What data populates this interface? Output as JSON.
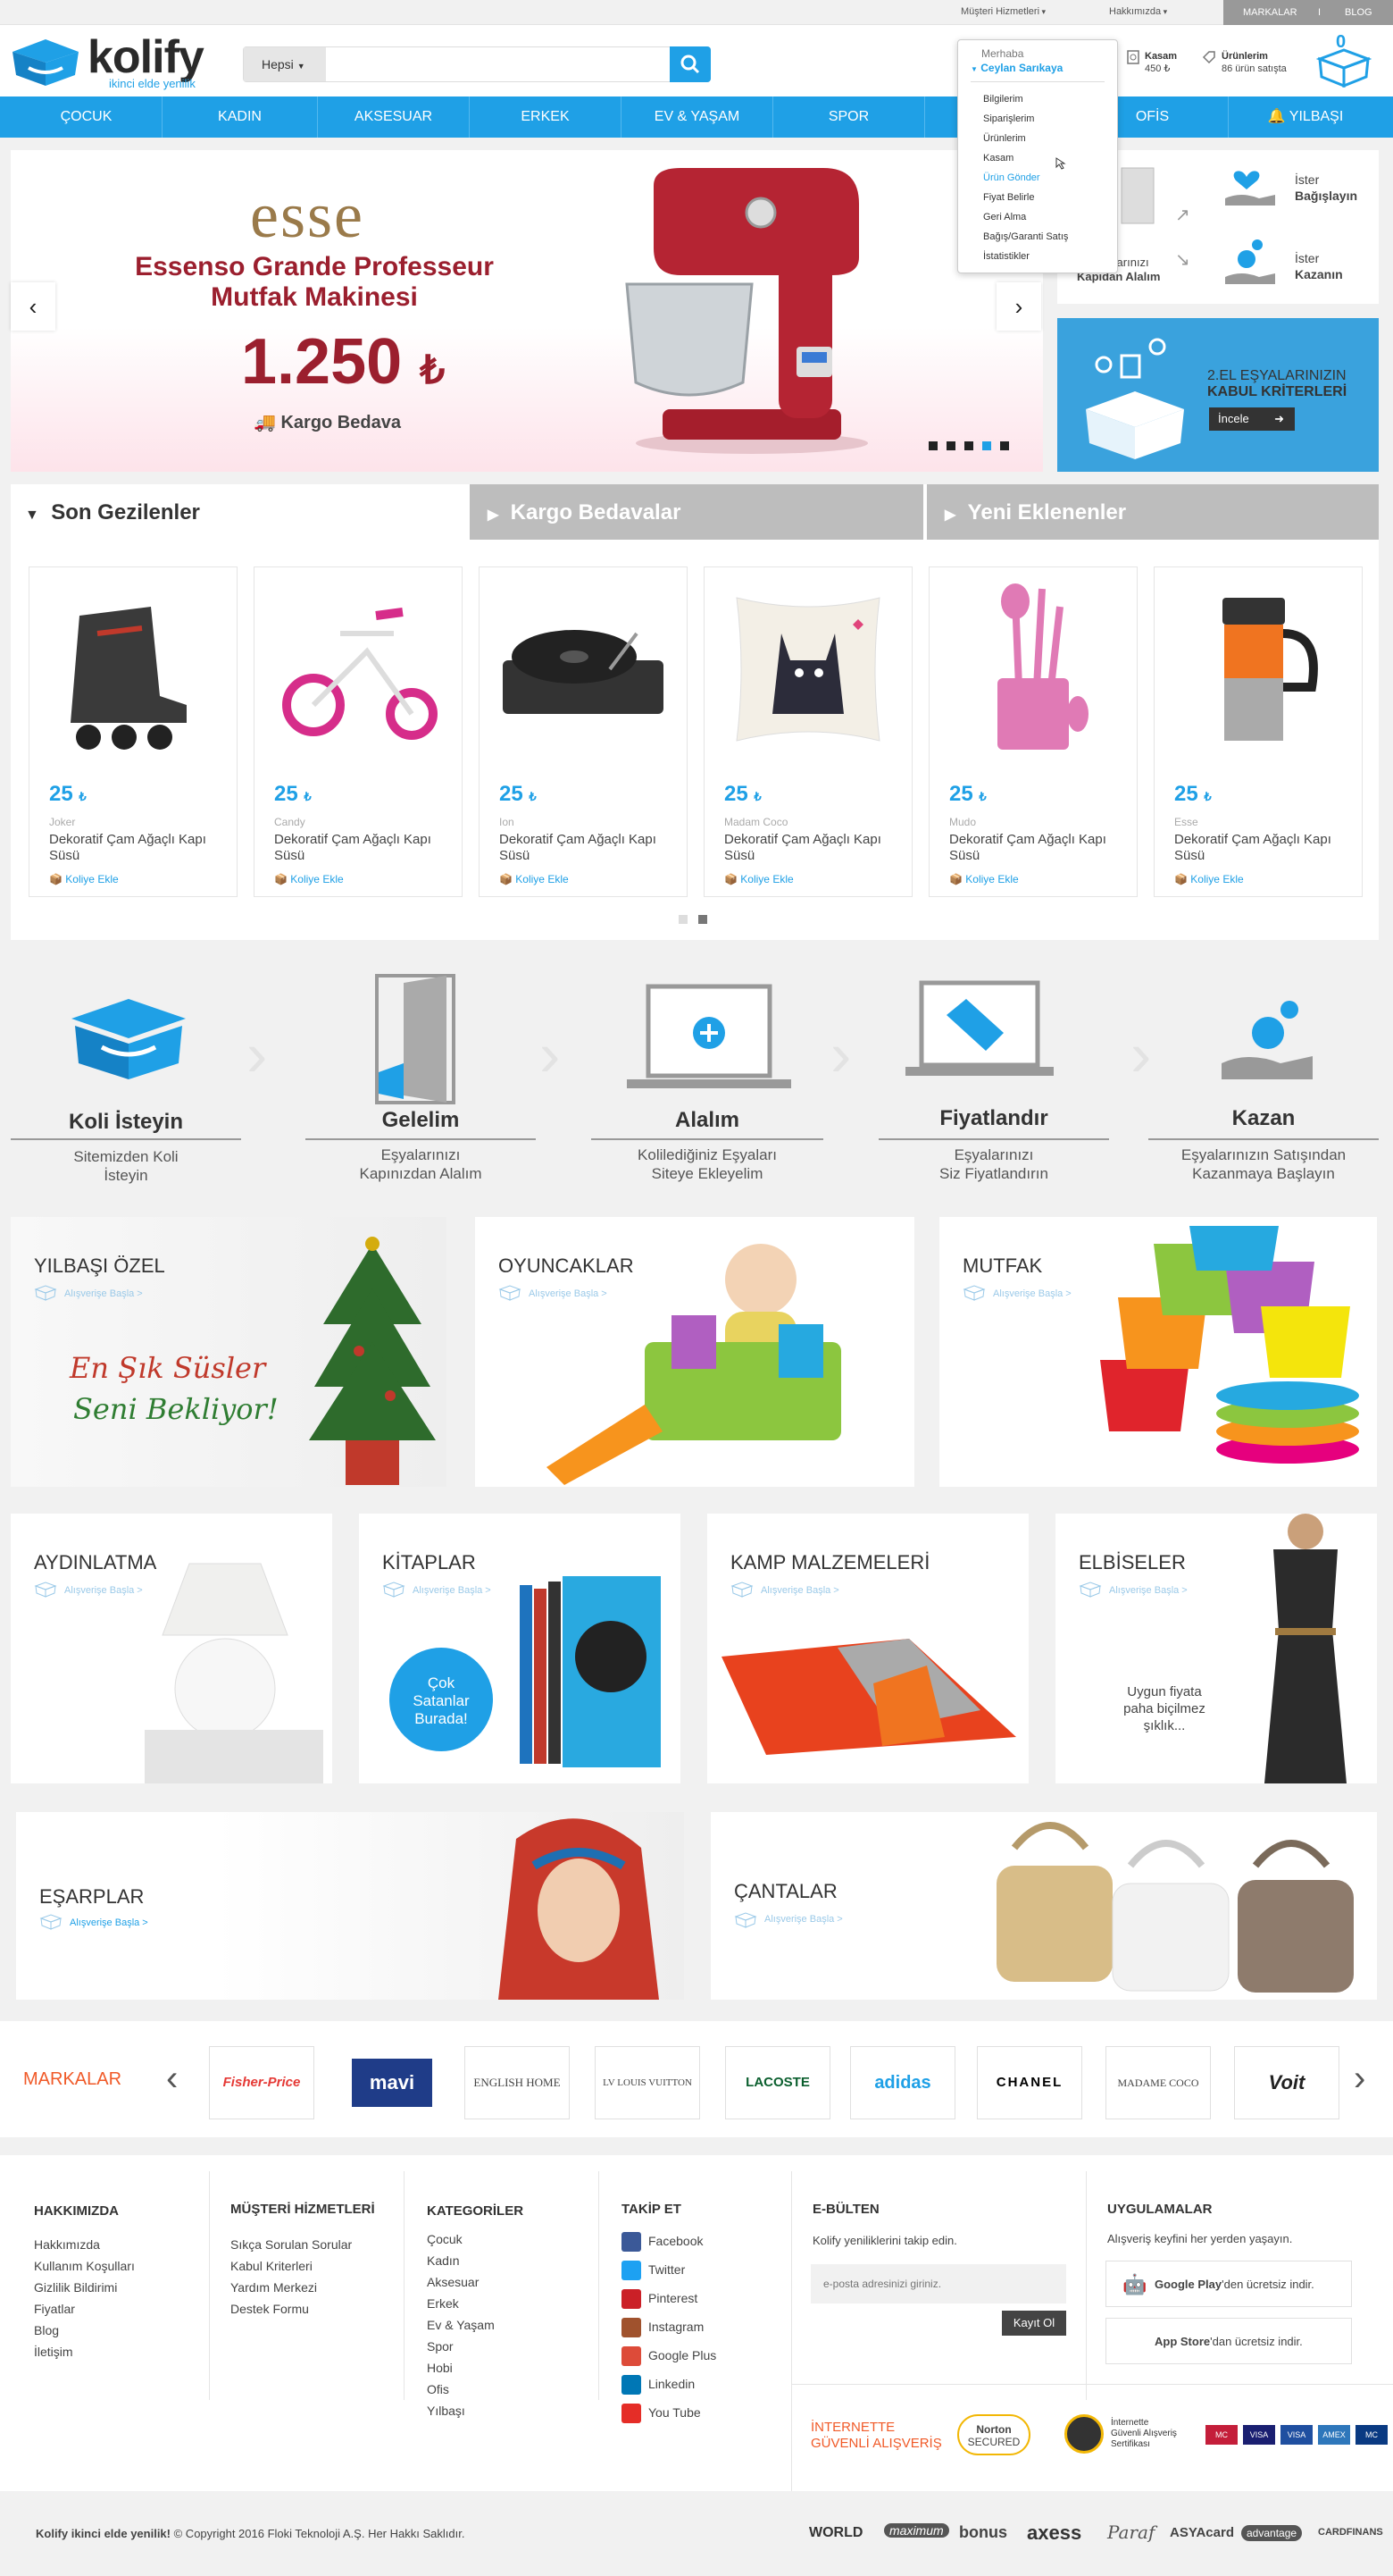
{
  "topbar": {
    "customer_service": "Müşteri Hizmetleri",
    "about": "Hakkımızda",
    "brands": "MARKALAR",
    "separator": "I",
    "blog": "BLOG"
  },
  "header": {
    "logo_text": "kolify",
    "logo_tagline": "ikinci elde yenilik",
    "search_category": "Hepsi",
    "search_placeholder": "",
    "safe_label": "Kasam",
    "safe_value": "450 ₺",
    "products_label": "Ürünlerim",
    "products_value": "86 ürün satışta",
    "cart_count": "0"
  },
  "user_menu": {
    "greeting": "Merhaba",
    "user_name": "Ceylan Sarıkaya",
    "items": [
      "Bilgilerim",
      "Siparişlerim",
      "Ürünlerim",
      "Kasam",
      "Ürün Gönder",
      "Fiyat Belirle",
      "Geri Alma",
      "Bağış/Garanti Satış",
      "İstatistikler"
    ],
    "active_index": 4
  },
  "nav": {
    "items": [
      "ÇOCUK",
      "KADIN",
      "AKSESUAR",
      "ERKEK",
      "EV & YAŞAM",
      "SPOR",
      "HOBİ",
      "OFİS",
      "YILBAŞI"
    ]
  },
  "slider": {
    "brand": "esse",
    "title_line1": "Essenso Grande Professeur",
    "title_line2": "Mutfak Makinesi",
    "price": "1.250",
    "currency": "₺",
    "shipping": "Kargo Bedava",
    "prev_icon": "‹",
    "next_icon": "›",
    "dots": 5,
    "active_dot": 3
  },
  "side_banner_1": {
    "left_text_line1": "Eşyalarınızı",
    "left_text_line2": "Kapıdan Alalım",
    "donate_pre": "İster",
    "donate": "Bağışlayın",
    "earn_pre": "İster",
    "earn": "Kazanın"
  },
  "side_banner_2": {
    "line1": "2.EL EŞYALARINIZIN",
    "line2": "KABUL KRİTERLERİ",
    "button": "İncele"
  },
  "tabs": {
    "items": [
      "Son Gezilenler",
      "Kargo Bedavalar",
      "Yeni Eklenenler"
    ],
    "active_index": 0
  },
  "products": [
    {
      "price": "25",
      "brand": "Joker",
      "name": "Dekoratif Çam Ağaçlı Kapı Süsü",
      "action": "Koliye Ekle",
      "icon": "inline-skate-icon"
    },
    {
      "price": "25",
      "brand": "Candy",
      "name": "Dekoratif Çam Ağaçlı Kapı Süsü",
      "action": "Koliye Ekle",
      "icon": "tricycle-icon"
    },
    {
      "price": "25",
      "brand": "Ion",
      "name": "Dekoratif Çam Ağaçlı Kapı Süsü",
      "action": "Koliye Ekle",
      "icon": "turntable-icon"
    },
    {
      "price": "25",
      "brand": "Madam Coco",
      "name": "Dekoratif Çam Ağaçlı Kapı Süsü",
      "action": "Koliye Ekle",
      "icon": "cat-pillow-icon"
    },
    {
      "price": "25",
      "brand": "Mudo",
      "name": "Dekoratif Çam Ağaçlı Kapı Süsü",
      "action": "Koliye Ekle",
      "icon": "kitchen-utensils-icon"
    },
    {
      "price": "25",
      "brand": "Esse",
      "name": "Dekoratif Çam Ağaçlı Kapı Süsü",
      "action": "Koliye Ekle",
      "icon": "travel-mug-icon"
    }
  ],
  "currency": "₺",
  "steps": [
    {
      "title": "Koli İsteyin",
      "desc_line1": "Sitemizden Koli",
      "desc_line2": "İsteyin"
    },
    {
      "title": "Gelelim",
      "desc_line1": "Eşyalarınızı",
      "desc_line2": "Kapınızdan Alalım"
    },
    {
      "title": "Alalım",
      "desc_line1": "Kolilediğiniz Eşyaları",
      "desc_line2": "Siteye Ekleyelim"
    },
    {
      "title": "Fiyatlandır",
      "desc_line1": "Eşyalarınızı",
      "desc_line2": "Siz Fiyatlandırın"
    },
    {
      "title": "Kazan",
      "desc_line1": "Eşyalarınızın Satışından",
      "desc_line2": "Kazanmaya Başlayın"
    }
  ],
  "category_tiles": {
    "shop_link": "Alışverişe Başla >",
    "row1": [
      "YILBAŞI ÖZEL",
      "OYUNCAKLAR",
      "MUTFAK"
    ],
    "row2": [
      "AYDINLATMA",
      "KİTAPLAR",
      "KAMP MALZEMELERİ",
      "ELBİSELER"
    ],
    "row3": [
      "EŞARPLAR",
      "ÇANTALAR"
    ],
    "xmas_line1": "En Şık Süsler",
    "xmas_line2": "Seni Bekliyor!",
    "books_badge_line1": "Çok",
    "books_badge_line2": "Satanlar",
    "books_badge_line3": "Burada!",
    "dress_line1": "Uygun fiyata",
    "dress_line2": "paha biçilmez şıklık..."
  },
  "brands": {
    "title": "MARKALAR",
    "items": [
      "Fisher-Price",
      "mavi",
      "ENGLISH HOME",
      "LV LOUIS VUITTON",
      "LACOSTE",
      "adidas",
      "CHANEL",
      "MADAME COCO",
      "Voit"
    ]
  },
  "footer": {
    "about_title": "HAKKIMIZDA",
    "about_links": [
      "Hakkımızda",
      "Kullanım Koşulları",
      "Gizlilik Bildirimi",
      "Fiyatlar",
      "Blog",
      "İletişim"
    ],
    "cs_title": "MÜŞTERİ HİZMETLERİ",
    "cs_links": [
      "Sıkça Sorulan Sorular",
      "Kabul Kriterleri",
      "Yardım Merkezi",
      "Destek Formu"
    ],
    "cat_title": "KATEGORİLER",
    "cat_links": [
      "Çocuk",
      "Kadın",
      "Aksesuar",
      "Erkek",
      "Ev & Yaşam",
      "Spor",
      "Hobi",
      "Ofis",
      "Yılbaşı"
    ],
    "follow_title": "TAKİP ET",
    "follow_links": [
      "Facebook",
      "Twitter",
      "Pinterest",
      "Instagram",
      "Google Plus",
      "Linkedin",
      "You Tube"
    ],
    "bulletin_title": "E-BÜLTEN",
    "bulletin_text": "Kolify yeniliklerini takip edin.",
    "bulletin_placeholder": "e-posta adresinizi giriniz.",
    "bulletin_button": "Kayıt Ol",
    "apps_title": "UYGULAMALAR",
    "apps_text": "Alışveriş keyfini her yerden yaşayın.",
    "gplay_bold": "Google Play",
    "gplay_rest": "'den ücretsiz indir.",
    "appstore_bold": "App Store",
    "appstore_rest": "'dan ücretsiz indir.",
    "secure_line1": "İNTERNETTE",
    "secure_line2": "GÜVENLİ ALIŞVERİŞ",
    "norton_line1": "Norton",
    "norton_line2": "SECURED",
    "ssl_line1": "İnternette",
    "ssl_line2": "Güvenli Alışveriş",
    "ssl_line3": "Sertifikası",
    "cards": [
      "MC",
      "VISA",
      "VISA",
      "AMEX",
      "MC"
    ]
  },
  "copyright": {
    "bold": "Kolify ikinci elde yenilik!",
    "text": " © Copyright 2016 Floki Teknoloji A.Ş. Her Hakkı Saklıdır.",
    "bank_logos": [
      "WORLD",
      "maximum",
      "bonus",
      "axess",
      "Paraf",
      "ASYAcard",
      "advantage",
      "CARDFINANS"
    ]
  },
  "colors": {
    "accent": "#1fa0e6",
    "dark_red": "#9b1f2e",
    "orange": "#f05a28",
    "tab_inactive": "#bdbdbd"
  }
}
